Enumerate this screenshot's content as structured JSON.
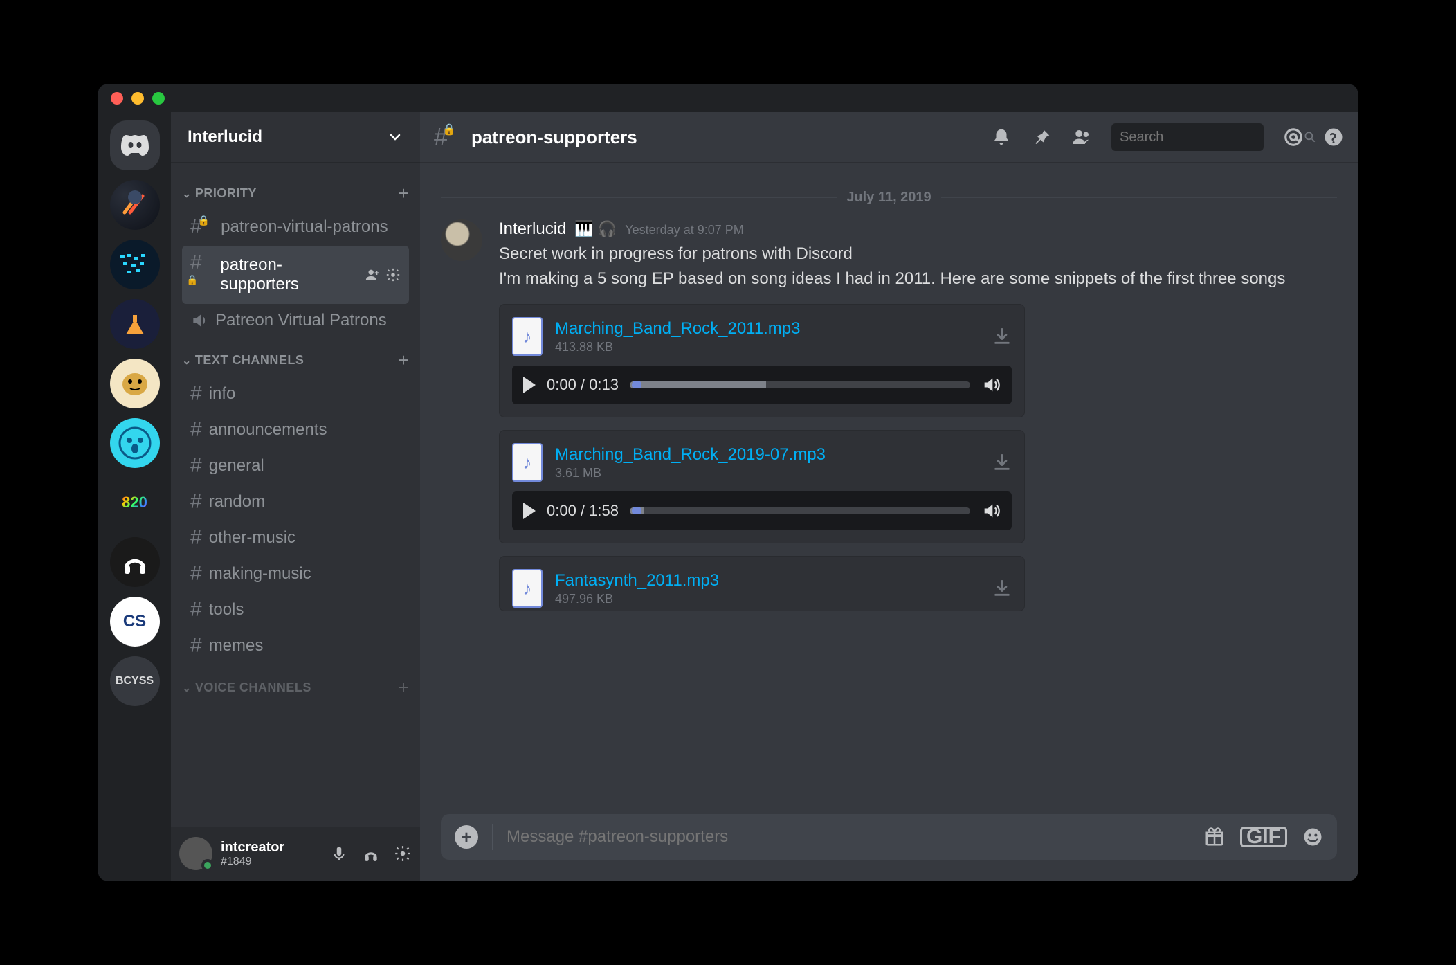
{
  "server": {
    "name": "Interlucid"
  },
  "sidebar": {
    "categories": [
      {
        "label": "PRIORITY",
        "channels": [
          {
            "name": "patreon-virtual-patrons",
            "locked": true,
            "type": "text"
          },
          {
            "name": "patreon-supporters",
            "locked": true,
            "type": "text",
            "active": true
          },
          {
            "name": "Patreon Virtual Patrons",
            "locked": false,
            "type": "voice"
          }
        ]
      },
      {
        "label": "TEXT CHANNELS",
        "channels": [
          {
            "name": "info",
            "type": "text"
          },
          {
            "name": "announcements",
            "type": "text"
          },
          {
            "name": "general",
            "type": "text"
          },
          {
            "name": "random",
            "type": "text"
          },
          {
            "name": "other-music",
            "type": "text"
          },
          {
            "name": "making-music",
            "type": "text"
          },
          {
            "name": "tools",
            "type": "text"
          },
          {
            "name": "memes",
            "type": "text"
          }
        ]
      },
      {
        "label": "VOICE CHANNELS",
        "channels": []
      }
    ]
  },
  "guilds": {
    "rainbow_text": "820",
    "bottom_text": "BCYSS"
  },
  "user_panel": {
    "name": "intcreator",
    "tag": "#1849"
  },
  "header": {
    "channel_name": "patreon-supporters",
    "search_placeholder": "Search"
  },
  "date_divider": "July 11, 2019",
  "message": {
    "author": "Interlucid",
    "badges": "🎹 🎧",
    "timestamp": "Yesterday at 9:07 PM",
    "line1": "Secret work in progress for patrons with Discord",
    "line2": "I'm making a 5 song EP based on song ideas I had in 2011.  Here are some snippets of the first three songs"
  },
  "attachments": [
    {
      "name": "Marching_Band_Rock_2011.mp3",
      "size": "413.88 KB",
      "current": "0:00",
      "total": "0:13",
      "progress_pct": 40,
      "thumb_pct": 2
    },
    {
      "name": "Marching_Band_Rock_2019-07.mp3",
      "size": "3.61 MB",
      "current": "0:00",
      "total": "1:58",
      "progress_pct": 4,
      "thumb_pct": 2
    },
    {
      "name": "Fantasynth_2011.mp3",
      "size": "497.96 KB",
      "no_player": true
    }
  ],
  "composer": {
    "placeholder": "Message #patreon-supporters"
  }
}
